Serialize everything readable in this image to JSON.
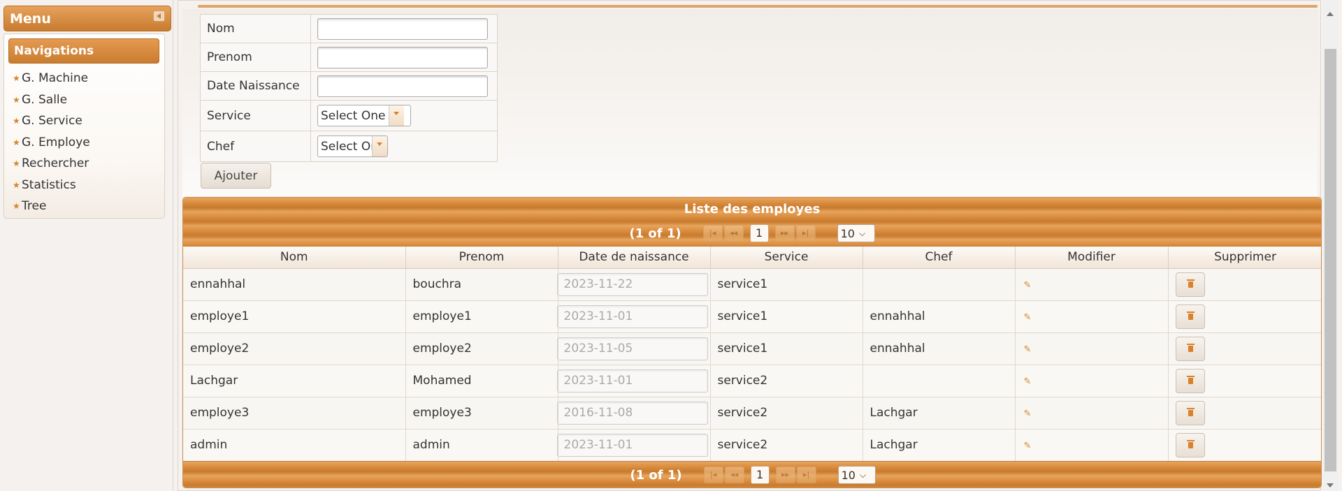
{
  "sidebar": {
    "title": "Menu",
    "nav_header": "Navigations",
    "items": [
      {
        "label": "G. Machine"
      },
      {
        "label": "G. Salle"
      },
      {
        "label": "G. Service"
      },
      {
        "label": "G. Employe"
      },
      {
        "label": "Rechercher"
      },
      {
        "label": "Statistics"
      },
      {
        "label": "Tree"
      }
    ]
  },
  "form": {
    "fields": [
      {
        "label": "Nom",
        "value": ""
      },
      {
        "label": "Prenom",
        "value": ""
      },
      {
        "label": "Date Naissance",
        "value": ""
      }
    ],
    "service": {
      "label": "Service",
      "selected": "Select One"
    },
    "chef": {
      "label": "Chef",
      "selected": "Select One"
    },
    "submit_label": "Ajouter"
  },
  "table": {
    "title": "Liste des employes",
    "paginator": {
      "status": "(1 of 1)",
      "page": "1",
      "rows_per_page": "10"
    },
    "columns": [
      "Nom",
      "Prenom",
      "Date de naissance",
      "Service",
      "Chef",
      "Modifier",
      "Supprimer"
    ],
    "rows": [
      {
        "nom": "ennahhal",
        "prenom": "bouchra",
        "date": "2023-11-22",
        "service": "service1",
        "chef": ""
      },
      {
        "nom": "employe1",
        "prenom": "employe1",
        "date": "2023-11-01",
        "service": "service1",
        "chef": "ennahhal"
      },
      {
        "nom": "employe2",
        "prenom": "employe2",
        "date": "2023-11-05",
        "service": "service1",
        "chef": "ennahhal"
      },
      {
        "nom": "Lachgar",
        "prenom": "Mohamed",
        "date": "2023-11-01",
        "service": "service2",
        "chef": ""
      },
      {
        "nom": "employe3",
        "prenom": "employe3",
        "date": "2016-11-08",
        "service": "service2",
        "chef": "Lachgar"
      },
      {
        "nom": "admin",
        "prenom": "admin",
        "date": "2023-11-01",
        "service": "service2",
        "chef": "Lachgar"
      }
    ]
  },
  "colors": {
    "accent": "#d9822b",
    "header_orange": "#c87b2f",
    "background": "#f4f1ee"
  }
}
